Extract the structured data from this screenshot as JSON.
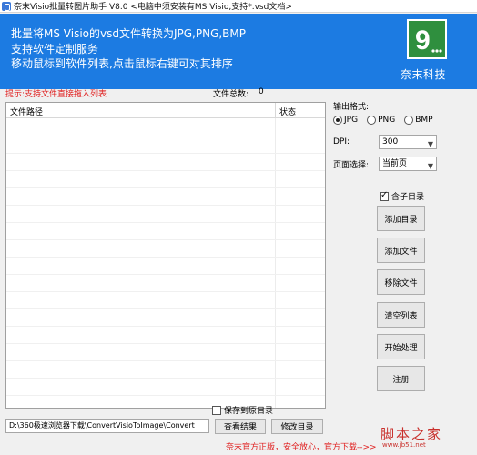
{
  "window": {
    "title": "奈末Visio批量转图片助手   V8.0   <电脑中须安装有MS Visio,支持*.vsd文档>"
  },
  "banner": {
    "line1": "批量将MS Visio的vsd文件转换为JPG,PNG,BMP",
    "line2": "支持软件定制服务",
    "line3": "移动鼠标到软件列表,点击鼠标右键可对其排序",
    "brand": "奈末科技",
    "logo_text": "9"
  },
  "list": {
    "hint": "提示:支持文件直接拖入列表",
    "count_label": "文件总数:",
    "count_value": "0",
    "columns": [
      "文件路径",
      "状态"
    ]
  },
  "settings": {
    "format_label": "输出格式:",
    "formats": [
      {
        "label": "JPG",
        "checked": true
      },
      {
        "label": "PNG",
        "checked": false
      },
      {
        "label": "BMP",
        "checked": false
      }
    ],
    "dpi_label": "DPI:",
    "dpi_value": "300",
    "page_label": "页面选择:",
    "page_value": "当前页",
    "include_subdir_label": "含子目录",
    "include_subdir_checked": true
  },
  "buttons": {
    "add_dir": "添加目录",
    "add_file": "添加文件",
    "remove_file": "移除文件",
    "clear_list": "清空列表",
    "start": "开始处理",
    "register": "注册",
    "view_result": "查看结果",
    "change_dir": "修改目录"
  },
  "output": {
    "save_to_source_label": "保存到原目录",
    "save_to_source_checked": false,
    "path_value": "D:\\360极速浏览器下载\\ConvertVisioToImage\\Convert"
  },
  "footer": {
    "text": "奈末官方正版，安全放心，官方下载-->>"
  },
  "watermark": {
    "text": "脚本之家",
    "url": "www.jb51.net"
  },
  "colors": {
    "banner": "#1c7be2",
    "logo": "#2f8f3e",
    "hint": "#e02020"
  }
}
